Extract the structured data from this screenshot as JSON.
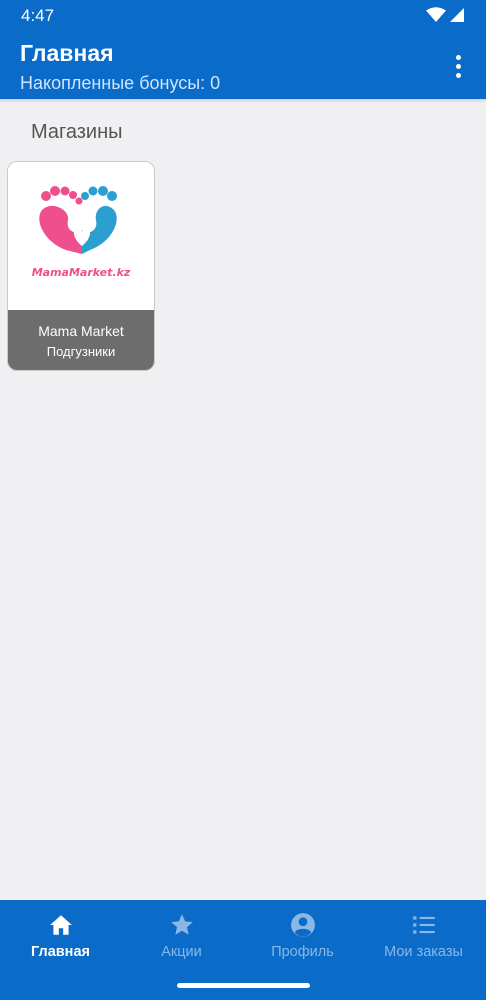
{
  "status_bar": {
    "time": "4:47"
  },
  "app_bar": {
    "title": "Главная",
    "subtitle": "Накопленные бонусы: 0"
  },
  "section": {
    "title": "Магазины"
  },
  "stores": [
    {
      "name": "Mama Market",
      "category": "Подгузники",
      "logo_text": "MamaMarket.kz"
    }
  ],
  "bottom_nav": [
    {
      "label": "Главная",
      "icon": "home-icon",
      "active": true
    },
    {
      "label": "Акции",
      "icon": "star-icon",
      "active": false
    },
    {
      "label": "Профиль",
      "icon": "account-circle-icon",
      "active": false
    },
    {
      "label": "Мои заказы",
      "icon": "list-icon",
      "active": false
    }
  ],
  "colors": {
    "primary": "#0a6bc8",
    "background": "#f0eff2",
    "card_footer": "#6d6d6d",
    "logo_pink": "#ef4f8d",
    "logo_blue": "#2a9fd0"
  }
}
